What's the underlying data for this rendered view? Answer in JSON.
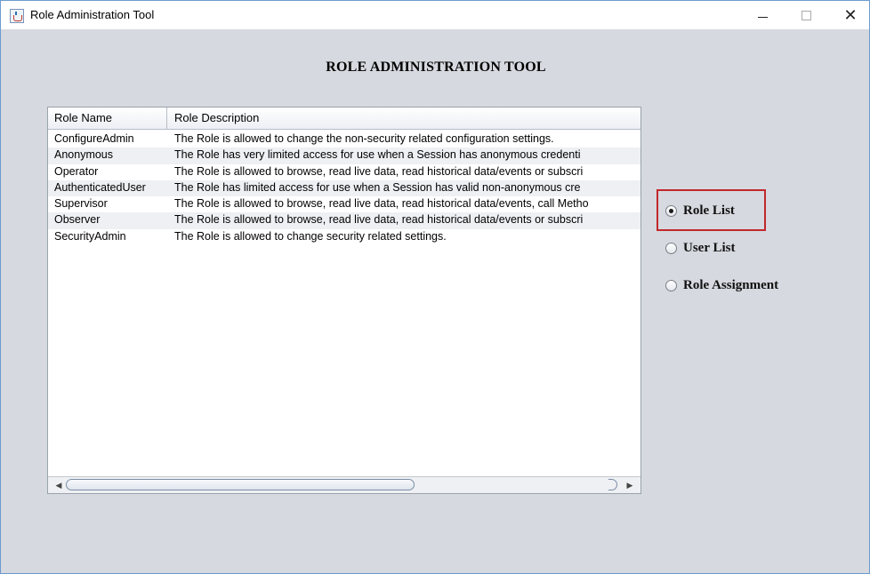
{
  "window": {
    "title": "Role Administration Tool",
    "controls": {
      "minimize": "minimize",
      "maximize": "maximize",
      "close": "✕"
    }
  },
  "heading": "ROLE ADMINISTRATION TOOL",
  "table": {
    "columns": [
      "Role Name",
      "Role Description"
    ],
    "rows": [
      {
        "name": "ConfigureAdmin",
        "description": "The Role is allowed to change the non-security related configuration settings."
      },
      {
        "name": "Anonymous",
        "description": "The Role has very limited access for use when a Session has anonymous credenti"
      },
      {
        "name": "Operator",
        "description": "The Role is allowed to browse, read live data, read historical data/events or subscri"
      },
      {
        "name": "AuthenticatedUser",
        "description": "The Role has limited access for use when a Session has valid non-anonymous cre"
      },
      {
        "name": "Supervisor",
        "description": "The Role is allowed to browse, read live data, read historical data/events, call Metho"
      },
      {
        "name": "Observer",
        "description": "The Role is allowed to browse, read live data, read historical data/events or subscri"
      },
      {
        "name": "SecurityAdmin",
        "description": "The Role is allowed to change security related settings."
      }
    ]
  },
  "radio_options": [
    {
      "label": "Role List",
      "selected": true
    },
    {
      "label": "User List",
      "selected": false
    },
    {
      "label": "Role Assignment",
      "selected": false
    }
  ],
  "colors": {
    "highlight": "#c0282d",
    "window_bg": "#d6d9df",
    "table_alt_row": "#eef0f4"
  }
}
